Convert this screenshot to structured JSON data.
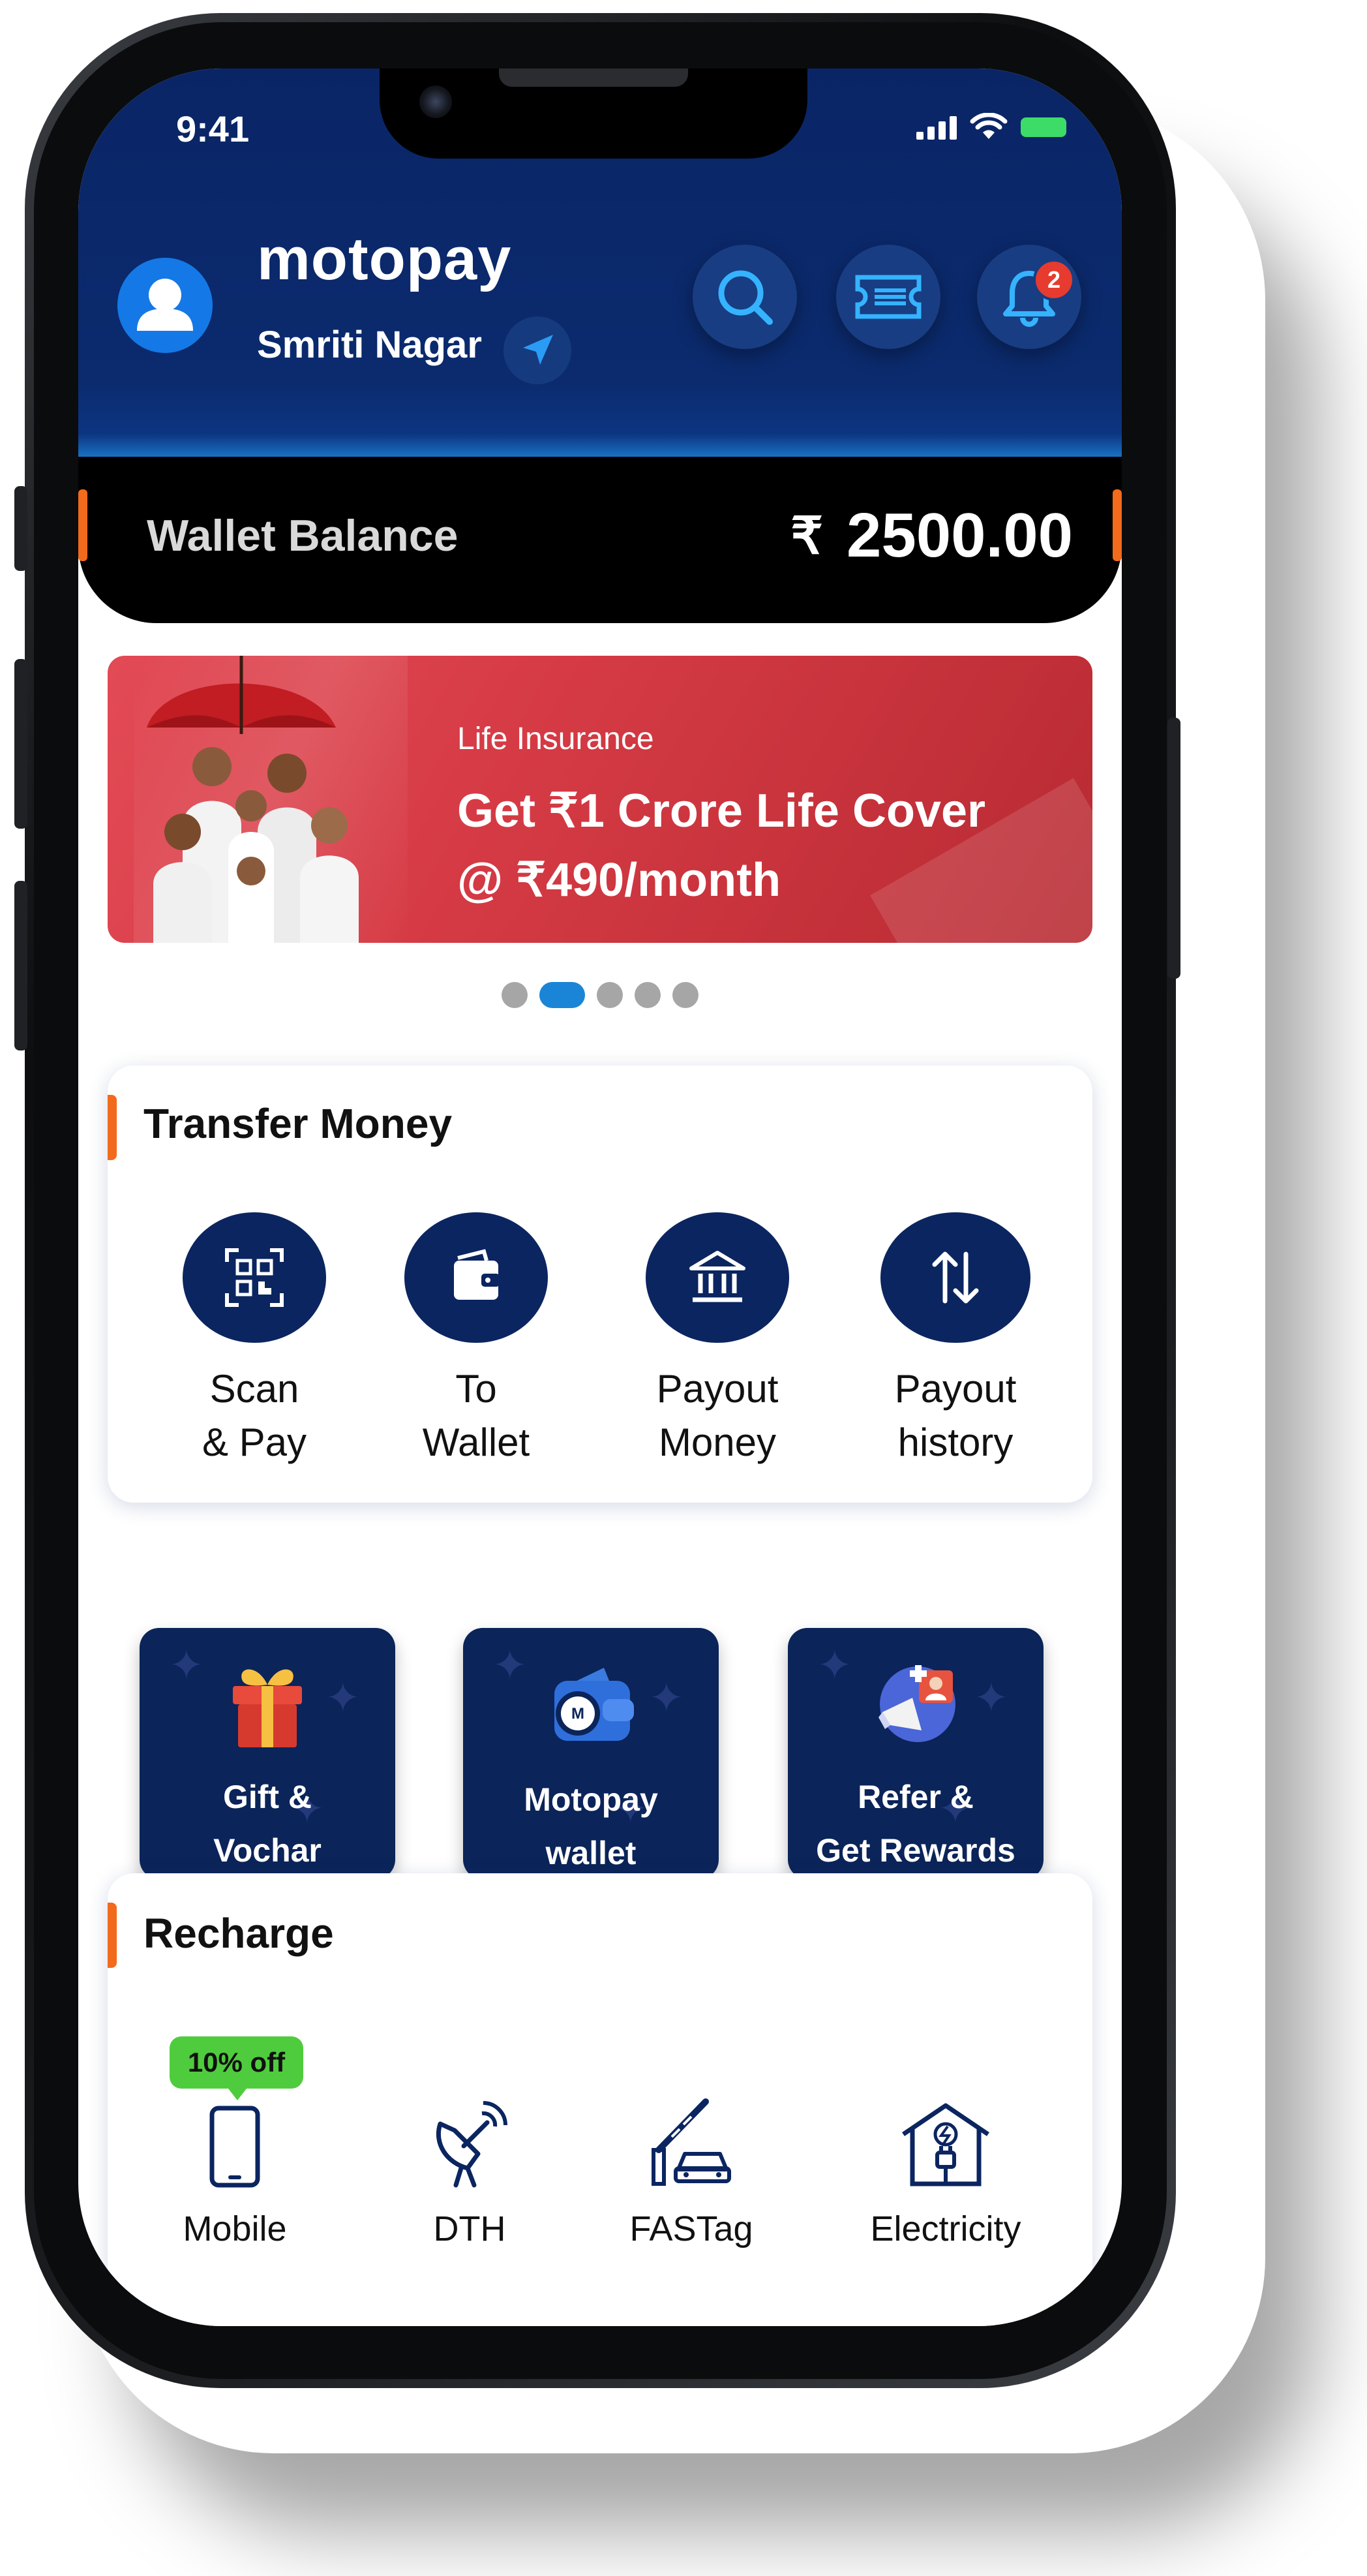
{
  "status_bar": {
    "time": "9:41"
  },
  "header": {
    "brand": "motopay",
    "location": "Smriti Nagar",
    "notification_count": "2"
  },
  "wallet": {
    "label": "Wallet Balance",
    "currency": "₹",
    "amount": "2500.00"
  },
  "banner": {
    "subtitle": "Life Insurance",
    "title": "Get ₹1 Crore Life Cover @ ₹490/month",
    "active_slide": 2,
    "total_slides": 5
  },
  "transfer_money": {
    "title": "Transfer Money",
    "items": [
      {
        "label": "Scan\n& Pay",
        "icon": "qr-scan-icon"
      },
      {
        "label": "To\nWallet",
        "icon": "wallet-icon"
      },
      {
        "label": "Payout\nMoney",
        "icon": "bank-icon"
      },
      {
        "label": "Payout\nhistory",
        "icon": "transfer-arrows-icon"
      }
    ]
  },
  "features": [
    {
      "label": "Gift &\nVochar",
      "icon": "gift-icon"
    },
    {
      "label": "Motopay\nwallet",
      "icon": "motopay-wallet-icon"
    },
    {
      "label": "Refer &\nGet Rewards",
      "icon": "refer-megaphone-icon"
    }
  ],
  "recharge": {
    "title": "Recharge",
    "offer_badge": "10% off",
    "items": [
      {
        "label": "Mobile",
        "icon": "mobile-icon"
      },
      {
        "label": "DTH",
        "icon": "satellite-dish-icon"
      },
      {
        "label": "FASTag",
        "icon": "fastag-icon"
      },
      {
        "label": "Electricity",
        "icon": "electricity-icon"
      }
    ]
  },
  "colors": {
    "header_bg": "#0b2b6e",
    "accent_orange": "#f26a1b",
    "icon_navy": "#0b2560",
    "banner_red": "#d63b45",
    "offer_green": "#4fcc3d",
    "notification_red": "#e63b2e"
  }
}
